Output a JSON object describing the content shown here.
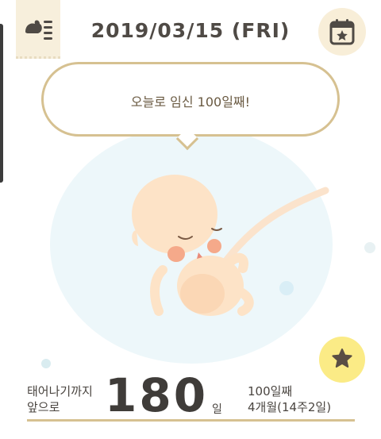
{
  "header": {
    "date": "2019/03/15 (FRI)"
  },
  "bubble": {
    "message": "오늘로 임신 100일째!"
  },
  "summary": {
    "until_birth_line1": "태어나기까지",
    "until_birth_line2": "앞으로",
    "days_left": "180",
    "days_unit": "일",
    "day_count": "100일째",
    "month_week": "4개월(14주2일)"
  },
  "icons": {
    "menu": "menu-icon",
    "calendar": "calendar-star-icon",
    "favorite": "star-icon"
  },
  "colors": {
    "accent_gold": "#d6c191",
    "favorite_yellow": "#fbeb86",
    "text_dark": "#4f4a45"
  }
}
